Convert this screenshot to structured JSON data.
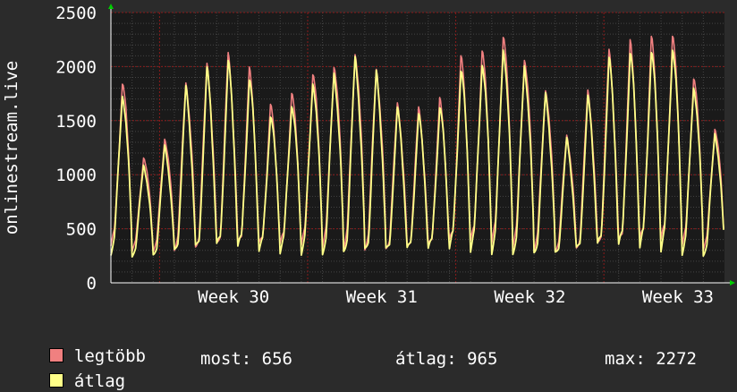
{
  "colors": {
    "background": "#2b2b2b",
    "plot_background": "#1a1a1a",
    "grid_minor": "#444444",
    "grid_major": "#8b1a1a",
    "series_max": "#f08080",
    "series_avg": "#ffff88",
    "arrow": "#00cc00"
  },
  "chart_data": {
    "type": "line",
    "ylabel": "onlinestream.live",
    "ylim": [
      0,
      2500
    ],
    "yticks": [
      "0",
      "500",
      "1000",
      "1500",
      "2000",
      "2500"
    ],
    "xticks": [
      "Week 30",
      "Week 31",
      "Week 32",
      "Week 33"
    ],
    "days": 29,
    "grid": true,
    "series": [
      {
        "name": "legtöbb",
        "color": "#f08080",
        "daily_peak": [
          1900,
          1200,
          1380,
          1900,
          2050,
          2120,
          1980,
          1650,
          1780,
          1990,
          2080,
          2200,
          2030,
          1680,
          1620,
          1700,
          2100,
          2180,
          2350,
          2150,
          1850,
          1400,
          1800,
          2150,
          2230,
          2280,
          2320,
          1950,
          1480
        ]
      },
      {
        "name": "átlag",
        "color": "#ffff88",
        "daily_peak": [
          1800,
          1120,
          1290,
          1820,
          1980,
          2050,
          1900,
          1580,
          1700,
          1920,
          2000,
          2120,
          1960,
          1610,
          1560,
          1640,
          2020,
          2100,
          2250,
          2070,
          1780,
          1340,
          1720,
          2080,
          2150,
          2200,
          2250,
          1880,
          1420
        ]
      }
    ]
  },
  "legend": {
    "items": [
      {
        "label": "legtöbb",
        "color": "#f08080"
      },
      {
        "label": "átlag",
        "color": "#ffff88"
      }
    ],
    "stats": {
      "most": "most: 656",
      "atlag": "átlag: 965",
      "max": "max: 2272"
    }
  }
}
